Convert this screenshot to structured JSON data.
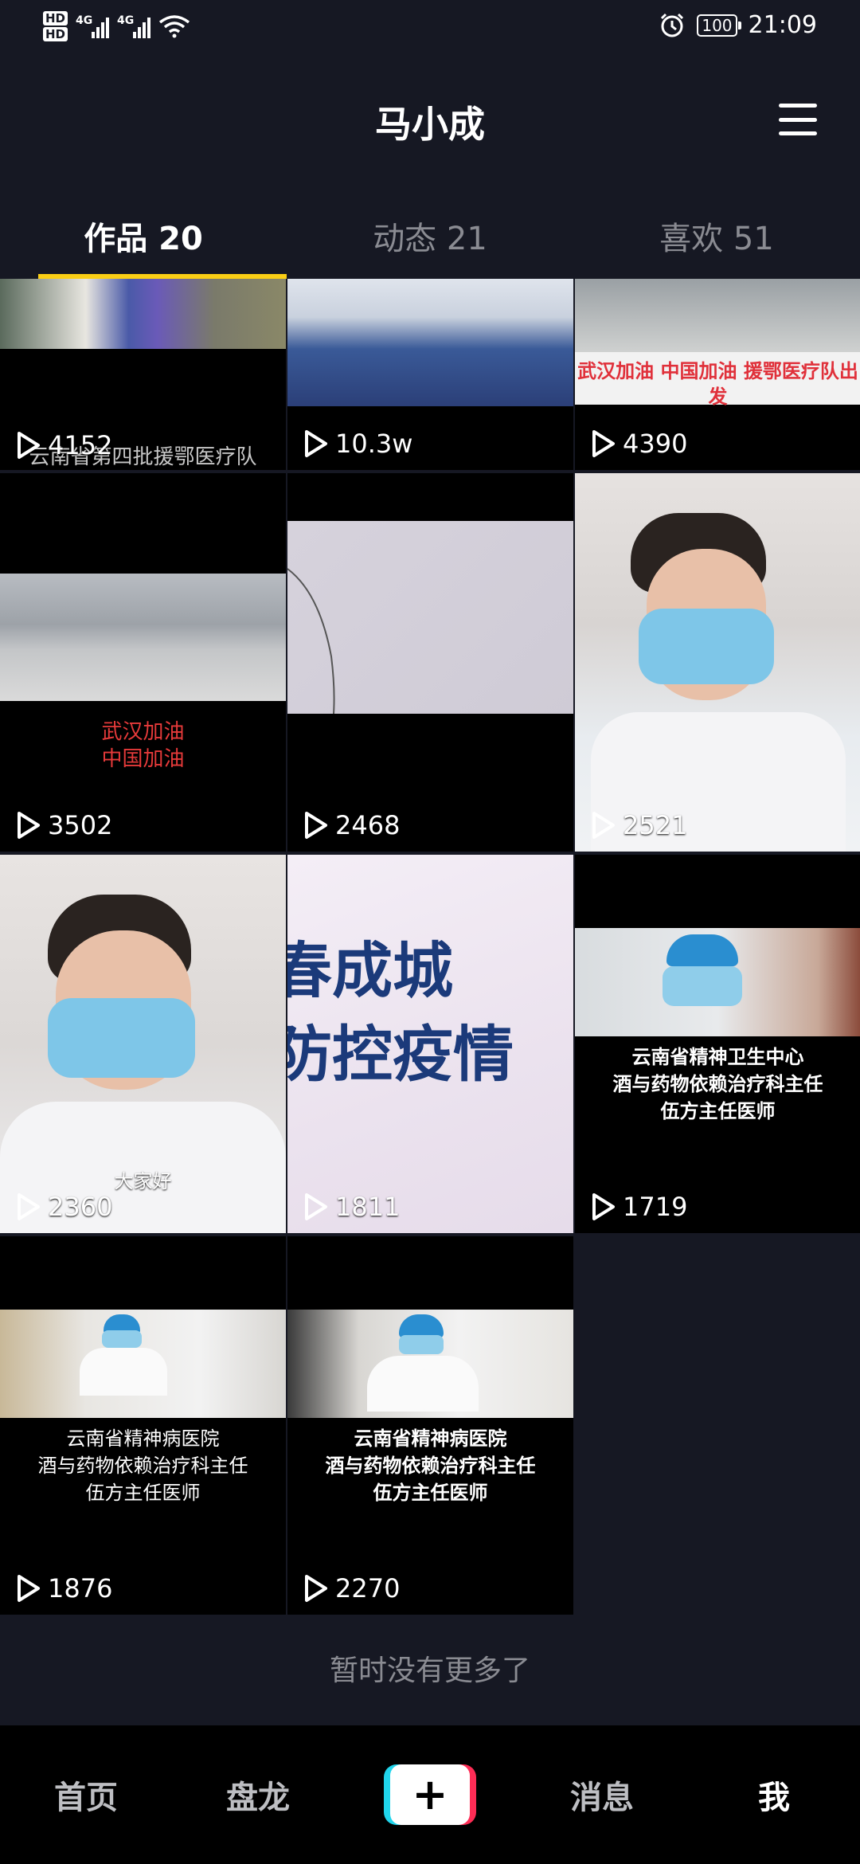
{
  "status_bar": {
    "hd1": "HD",
    "hd2": "HD",
    "net1": "4G",
    "net2": "4G",
    "battery": "100",
    "time": "21:09"
  },
  "header": {
    "title": "马小成"
  },
  "tabs": [
    {
      "label": "作品 20",
      "active": true
    },
    {
      "label": "动态 21",
      "active": false
    },
    {
      "label": "喜欢 51",
      "active": false
    }
  ],
  "videos": [
    {
      "views": "4152",
      "caption": "云南省第四批援鄂医疗队"
    },
    {
      "views": "10.3w",
      "caption": ""
    },
    {
      "views": "4390",
      "caption": "武汉加油 中国加油 援鄂医疗队出发"
    },
    {
      "views": "3502",
      "caption_line1": "武汉加油",
      "caption_line2": "中国加油"
    },
    {
      "views": "2468"
    },
    {
      "views": "2521"
    },
    {
      "views": "2360",
      "caption": "大家好"
    },
    {
      "views": "1811",
      "overlay_line1": "春成城",
      "overlay_line2": "防控疫情"
    },
    {
      "views": "1719",
      "caption_line1": "云南省精神卫生中心",
      "caption_line2": "酒与药物依赖治疗科主任",
      "caption_line3": "伍方主任医师"
    },
    {
      "views": "1876",
      "caption_line1": "云南省精神病医院",
      "caption_line2": "酒与药物依赖治疗科主任",
      "caption_line3": "伍方主任医师"
    },
    {
      "views": "2270",
      "caption_line1": "云南省精神病医院",
      "caption_line2": "酒与药物依赖治疗科主任",
      "caption_line3": "伍方主任医师"
    }
  ],
  "footer": {
    "no_more": "暂时没有更多了"
  },
  "nav": {
    "home": "首页",
    "city": "盘龙",
    "plus": "+",
    "messages": "消息",
    "me": "我"
  },
  "colors": {
    "background": "#161823",
    "tab_indicator": "#face15",
    "accent_red": "#fe2c55",
    "accent_cyan": "#20d5ec"
  }
}
